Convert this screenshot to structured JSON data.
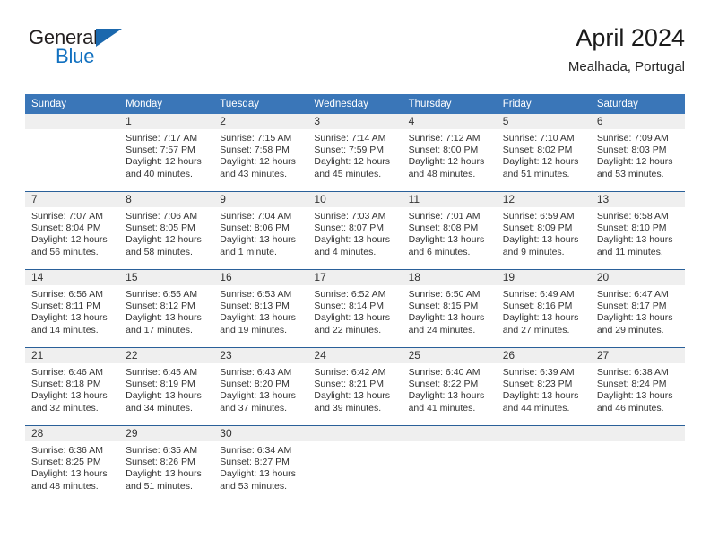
{
  "brand": {
    "name_top": "General",
    "name_bottom": "Blue",
    "colors": {
      "text_dark": "#231f20",
      "blue": "#1271c0",
      "triangle": "#1b68ad"
    }
  },
  "header": {
    "title": "April 2024",
    "location": "Mealhada, Portugal"
  },
  "theme": {
    "header_bg": "#3a76b8",
    "header_text": "#ffffff",
    "daynum_band_bg": "#efefef",
    "row_separator": "#2a6099",
    "body_text": "#333333"
  },
  "calendar": {
    "weekday_headers": [
      "Sunday",
      "Monday",
      "Tuesday",
      "Wednesday",
      "Thursday",
      "Friday",
      "Saturday"
    ],
    "weeks": [
      [
        {
          "day": "",
          "lines": []
        },
        {
          "day": "1",
          "lines": [
            "Sunrise: 7:17 AM",
            "Sunset: 7:57 PM",
            "Daylight: 12 hours",
            "and 40 minutes."
          ]
        },
        {
          "day": "2",
          "lines": [
            "Sunrise: 7:15 AM",
            "Sunset: 7:58 PM",
            "Daylight: 12 hours",
            "and 43 minutes."
          ]
        },
        {
          "day": "3",
          "lines": [
            "Sunrise: 7:14 AM",
            "Sunset: 7:59 PM",
            "Daylight: 12 hours",
            "and 45 minutes."
          ]
        },
        {
          "day": "4",
          "lines": [
            "Sunrise: 7:12 AM",
            "Sunset: 8:00 PM",
            "Daylight: 12 hours",
            "and 48 minutes."
          ]
        },
        {
          "day": "5",
          "lines": [
            "Sunrise: 7:10 AM",
            "Sunset: 8:02 PM",
            "Daylight: 12 hours",
            "and 51 minutes."
          ]
        },
        {
          "day": "6",
          "lines": [
            "Sunrise: 7:09 AM",
            "Sunset: 8:03 PM",
            "Daylight: 12 hours",
            "and 53 minutes."
          ]
        }
      ],
      [
        {
          "day": "7",
          "lines": [
            "Sunrise: 7:07 AM",
            "Sunset: 8:04 PM",
            "Daylight: 12 hours",
            "and 56 minutes."
          ]
        },
        {
          "day": "8",
          "lines": [
            "Sunrise: 7:06 AM",
            "Sunset: 8:05 PM",
            "Daylight: 12 hours",
            "and 58 minutes."
          ]
        },
        {
          "day": "9",
          "lines": [
            "Sunrise: 7:04 AM",
            "Sunset: 8:06 PM",
            "Daylight: 13 hours",
            "and 1 minute."
          ]
        },
        {
          "day": "10",
          "lines": [
            "Sunrise: 7:03 AM",
            "Sunset: 8:07 PM",
            "Daylight: 13 hours",
            "and 4 minutes."
          ]
        },
        {
          "day": "11",
          "lines": [
            "Sunrise: 7:01 AM",
            "Sunset: 8:08 PM",
            "Daylight: 13 hours",
            "and 6 minutes."
          ]
        },
        {
          "day": "12",
          "lines": [
            "Sunrise: 6:59 AM",
            "Sunset: 8:09 PM",
            "Daylight: 13 hours",
            "and 9 minutes."
          ]
        },
        {
          "day": "13",
          "lines": [
            "Sunrise: 6:58 AM",
            "Sunset: 8:10 PM",
            "Daylight: 13 hours",
            "and 11 minutes."
          ]
        }
      ],
      [
        {
          "day": "14",
          "lines": [
            "Sunrise: 6:56 AM",
            "Sunset: 8:11 PM",
            "Daylight: 13 hours",
            "and 14 minutes."
          ]
        },
        {
          "day": "15",
          "lines": [
            "Sunrise: 6:55 AM",
            "Sunset: 8:12 PM",
            "Daylight: 13 hours",
            "and 17 minutes."
          ]
        },
        {
          "day": "16",
          "lines": [
            "Sunrise: 6:53 AM",
            "Sunset: 8:13 PM",
            "Daylight: 13 hours",
            "and 19 minutes."
          ]
        },
        {
          "day": "17",
          "lines": [
            "Sunrise: 6:52 AM",
            "Sunset: 8:14 PM",
            "Daylight: 13 hours",
            "and 22 minutes."
          ]
        },
        {
          "day": "18",
          "lines": [
            "Sunrise: 6:50 AM",
            "Sunset: 8:15 PM",
            "Daylight: 13 hours",
            "and 24 minutes."
          ]
        },
        {
          "day": "19",
          "lines": [
            "Sunrise: 6:49 AM",
            "Sunset: 8:16 PM",
            "Daylight: 13 hours",
            "and 27 minutes."
          ]
        },
        {
          "day": "20",
          "lines": [
            "Sunrise: 6:47 AM",
            "Sunset: 8:17 PM",
            "Daylight: 13 hours",
            "and 29 minutes."
          ]
        }
      ],
      [
        {
          "day": "21",
          "lines": [
            "Sunrise: 6:46 AM",
            "Sunset: 8:18 PM",
            "Daylight: 13 hours",
            "and 32 minutes."
          ]
        },
        {
          "day": "22",
          "lines": [
            "Sunrise: 6:45 AM",
            "Sunset: 8:19 PM",
            "Daylight: 13 hours",
            "and 34 minutes."
          ]
        },
        {
          "day": "23",
          "lines": [
            "Sunrise: 6:43 AM",
            "Sunset: 8:20 PM",
            "Daylight: 13 hours",
            "and 37 minutes."
          ]
        },
        {
          "day": "24",
          "lines": [
            "Sunrise: 6:42 AM",
            "Sunset: 8:21 PM",
            "Daylight: 13 hours",
            "and 39 minutes."
          ]
        },
        {
          "day": "25",
          "lines": [
            "Sunrise: 6:40 AM",
            "Sunset: 8:22 PM",
            "Daylight: 13 hours",
            "and 41 minutes."
          ]
        },
        {
          "day": "26",
          "lines": [
            "Sunrise: 6:39 AM",
            "Sunset: 8:23 PM",
            "Daylight: 13 hours",
            "and 44 minutes."
          ]
        },
        {
          "day": "27",
          "lines": [
            "Sunrise: 6:38 AM",
            "Sunset: 8:24 PM",
            "Daylight: 13 hours",
            "and 46 minutes."
          ]
        }
      ],
      [
        {
          "day": "28",
          "lines": [
            "Sunrise: 6:36 AM",
            "Sunset: 8:25 PM",
            "Daylight: 13 hours",
            "and 48 minutes."
          ]
        },
        {
          "day": "29",
          "lines": [
            "Sunrise: 6:35 AM",
            "Sunset: 8:26 PM",
            "Daylight: 13 hours",
            "and 51 minutes."
          ]
        },
        {
          "day": "30",
          "lines": [
            "Sunrise: 6:34 AM",
            "Sunset: 8:27 PM",
            "Daylight: 13 hours",
            "and 53 minutes."
          ]
        },
        {
          "day": "",
          "lines": []
        },
        {
          "day": "",
          "lines": []
        },
        {
          "day": "",
          "lines": []
        },
        {
          "day": "",
          "lines": []
        }
      ]
    ]
  }
}
